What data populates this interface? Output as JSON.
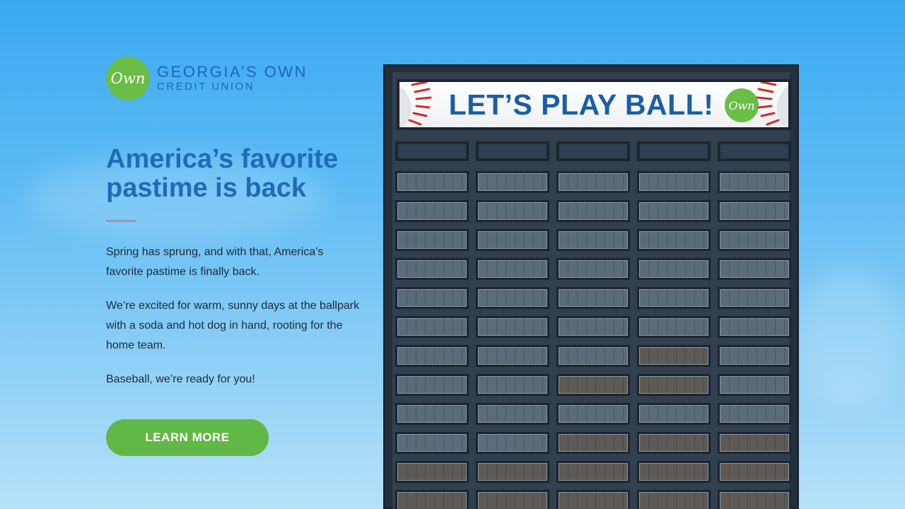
{
  "logo": {
    "badge_text": "Own",
    "name_line1": "GEORGIA’S OWN",
    "name_line2": "CREDIT UNION",
    "brand_green": "#6abd45",
    "brand_blue": "#1f66b5"
  },
  "headline": {
    "line1": "America’s favorite",
    "line2": "pastime is back"
  },
  "body": {
    "paragraph1": "Spring has sprung, and with that, America’s favorite pastime is finally back.",
    "paragraph2": "We’re excited for warm, sunny days at the ballpark with a soda and hot dog in hand, rooting for the home team.",
    "paragraph3": "Baseball, we’re ready for you!"
  },
  "cta": {
    "label": "LEARN MORE",
    "color": "#62b846"
  },
  "scoreboard": {
    "banner_text": "LET’S PLAY BALL!",
    "banner_badge": "Own",
    "stitch_color": "#d32a2a"
  }
}
